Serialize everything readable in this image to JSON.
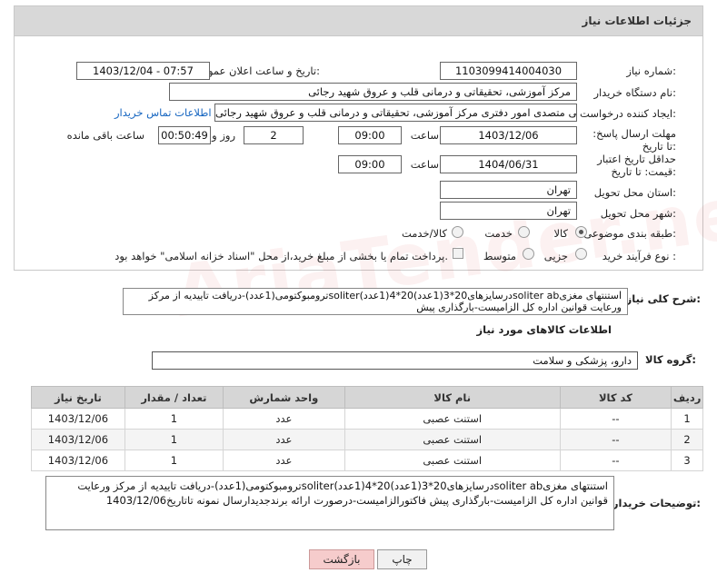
{
  "header": {
    "title": "جزئیات اطلاعات نیاز"
  },
  "fields": {
    "need_number_label": "شماره نیاز:",
    "need_number": "1103099414004030",
    "announce_label": "تاریخ و ساعت اعلان عمومی:",
    "announce_value": "1403/12/04 - 07:57",
    "buyer_org_label": "نام دستگاه خریدار:",
    "buyer_org": "مرکز آموزشی، تحقیقاتی و درمانی قلب و عروق شهید رجائی",
    "requester_label": "ایجاد کننده درخواست:",
    "requester": "حسین سلجوقی متصدی امور دفتری مرکز آموزشی، تحقیقاتی و درمانی قلب و عروق شهید رجائی",
    "contact_link": "اطلاعات تماس خریدار",
    "deadline_label": "مهلت ارسال پاسخ: تا تاریخ:",
    "deadline_date": "1403/12/06",
    "time_label": "ساعت",
    "deadline_time": "09:00",
    "days_value": "2",
    "days_label": "روز و",
    "remaining_value": "00:50:49",
    "remaining_label": "ساعت باقی مانده",
    "validity_label": "حداقل تاریخ اعتبار قیمت: تا تاریخ:",
    "validity_date": "1404/06/31",
    "validity_time": "09:00",
    "province_label": "استان محل تحویل:",
    "province": "تهران",
    "city_label": "شهر محل تحویل:",
    "city": "تهران",
    "category_label": "طبقه بندی موضوعی:",
    "category_options": [
      "کالا",
      "خدمت",
      "کالا/خدمت"
    ],
    "process_label": "نوع فرآیند خرید :",
    "process_options": [
      "جزیی",
      "متوسط"
    ],
    "payment_note": "پرداخت تمام یا بخشی از مبلغ خرید،از محل \"اسناد خزانه اسلامی\" خواهد بود."
  },
  "description": {
    "label": "شرح کلی نیاز:",
    "text": "استنتهای مغزیsoliter abدرسایزهای20*3(1عدد)20*4(1عدد)soliterترومبوکتومی(1عدد)-دریافت تاییدیه از مرکز ورعایت قوانین اداره کل الزامیست-بارگذاری پیش"
  },
  "goods": {
    "section_title": "اطلاعات کالاهای مورد نیاز",
    "group_label": "گروه کالا:",
    "group_value": "دارو، پزشکی و سلامت",
    "columns": [
      "ردیف",
      "کد کالا",
      "نام کالا",
      "واحد شمارش",
      "تعداد / مقدار",
      "تاریخ نیاز"
    ],
    "rows": [
      [
        "1",
        "--",
        "استنت عصبی",
        "عدد",
        "1",
        "1403/12/06"
      ],
      [
        "2",
        "--",
        "استنت عصبی",
        "عدد",
        "1",
        "1403/12/06"
      ],
      [
        "3",
        "--",
        "استنت عصبی",
        "عدد",
        "1",
        "1403/12/06"
      ]
    ]
  },
  "buyer_notes": {
    "label": "توضیحات خریدار:",
    "text": "استنتهای مغزیsoliter abدرسایزهای20*3(1عدد)20*4(1عدد)soliterترومبوکتومی(1عدد)-دریافت تاییدیه از مرکز ورعایت قوانین اداره کل الزامیست-بارگذاری پیش فاکتورالزامیست-درصورت ارائه برندجدیدارسال نمونه تاتاریخ1403/12/06"
  },
  "buttons": {
    "print": "چاپ",
    "back": "بازگشت"
  }
}
